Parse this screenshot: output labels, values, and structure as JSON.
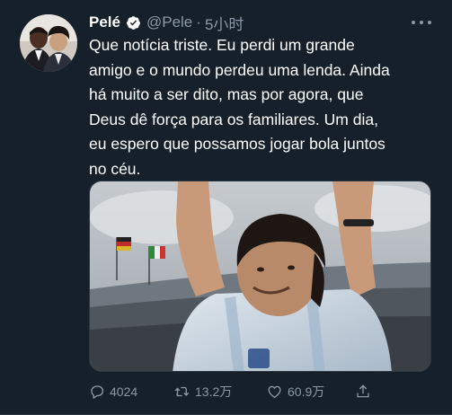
{
  "tweet": {
    "display_name": "Pelé",
    "verified": true,
    "handle": "@Pele",
    "separator": "·",
    "timestamp": "5小时",
    "text": "Que notícia triste. Eu perdi um grande\namigo e o mundo perdeu uma lenda. Ainda\nhá muito a ser dito, mas por agora, que\nDeus dê força para os familiares. Um dia,\neu espero que possamos jogar bola juntos\nno céu.",
    "media_icon": "photo"
  },
  "actions": {
    "reply_count": "4024",
    "retweet_count": "13.2万",
    "like_count": "60.9万"
  },
  "icons": {
    "verified": "verified-badge-icon",
    "more": "more-options-icon",
    "reply": "reply-icon",
    "retweet": "retweet-icon",
    "like": "heart-icon",
    "share": "share-icon"
  },
  "colors": {
    "background": "#15202b",
    "text": "#ffffff",
    "secondary_text": "#8b98a5",
    "divider": "#2b3844"
  }
}
